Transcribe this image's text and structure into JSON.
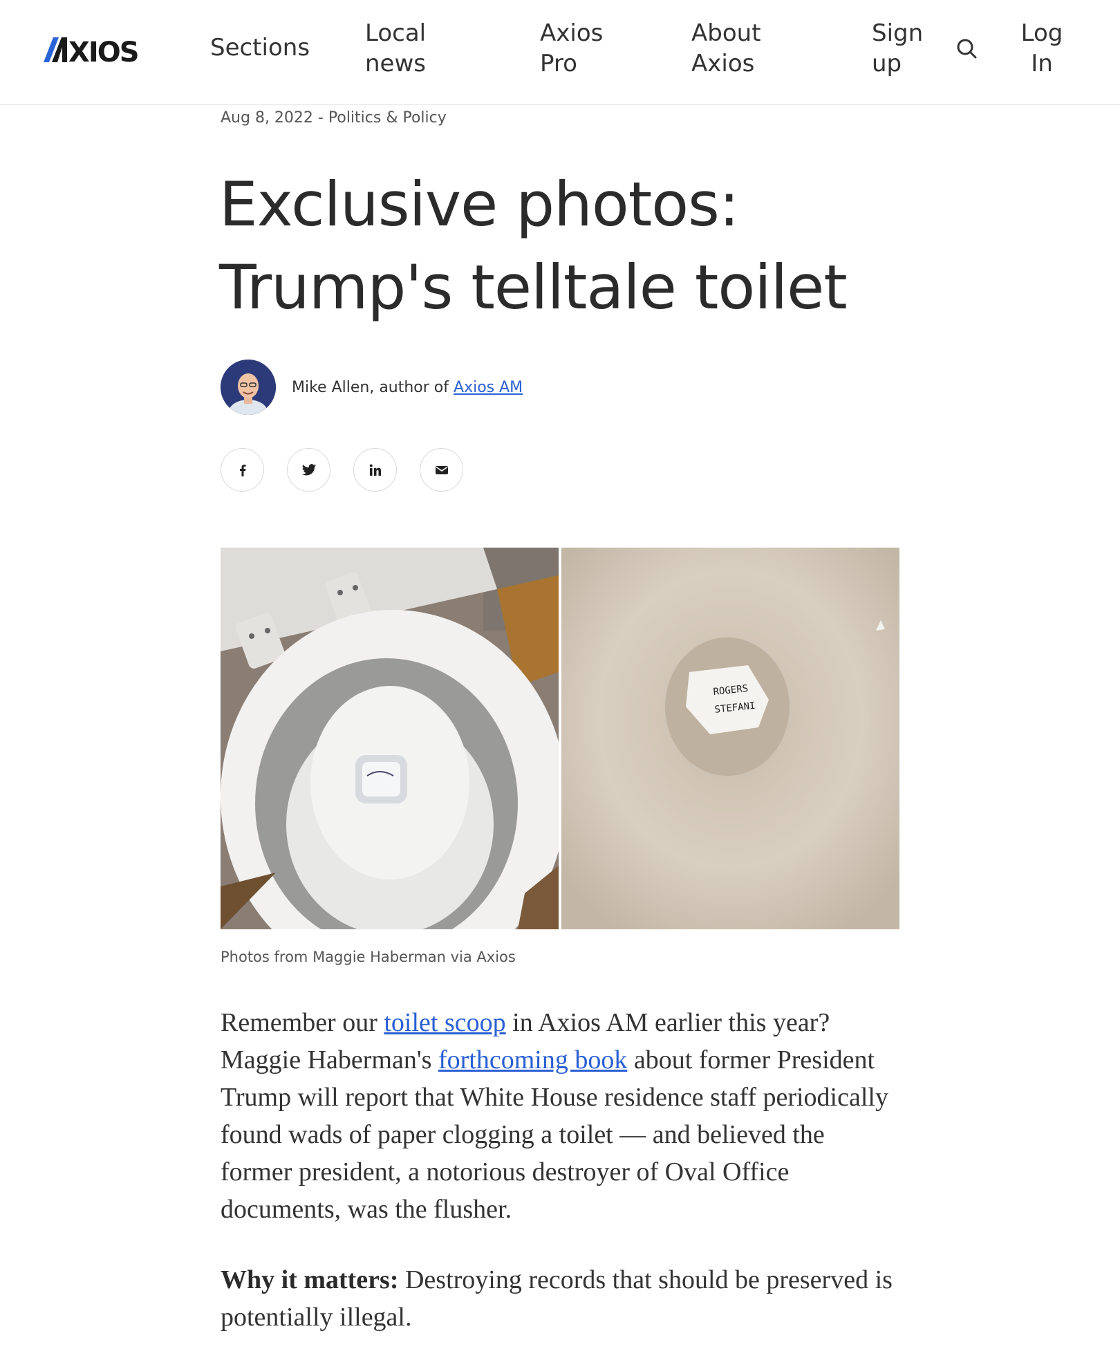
{
  "header": {
    "logo_text": "AXIOS",
    "nav": {
      "sections": "Sections",
      "local_news": "Local news",
      "axios_pro": "Axios Pro",
      "about": "About Axios",
      "sign_up": "Sign up",
      "log_in": "Log In"
    },
    "search_icon": "search-icon"
  },
  "article": {
    "date": "Aug 8, 2022",
    "separator": " - ",
    "category": "Politics & Policy",
    "headline": "Exclusive photos: Trump's telltale toilet",
    "byline": {
      "author_prefix": "Mike Allen, author of ",
      "author_link": "Axios AM"
    },
    "share": [
      "facebook-icon",
      "twitter-icon",
      "linkedin-icon",
      "email-icon"
    ],
    "photo_left_note_text": "",
    "photo_right_note_lines": [
      "ROGERS",
      "STEFANI"
    ],
    "caption": "Photos from Maggie Haberman via Axios",
    "p1": {
      "t1": "Remember our ",
      "link1": "toilet scoop",
      "t2": " in Axios AM earlier this year? Maggie Haberman's ",
      "link2": "forthcoming book",
      "t3": " about former President Trump will report that White House residence staff periodically found wads of paper clogging a toilet — and believed the former president, a notorious destroyer of Oval Office documents, was the flusher."
    },
    "p2": {
      "lead": "Why it matters:",
      "text": " Destroying records that should be preserved is potentially illegal."
    }
  },
  "colors": {
    "link": "#2a5fd4",
    "logo_accent": "#2a63d6",
    "text": "#333333"
  }
}
